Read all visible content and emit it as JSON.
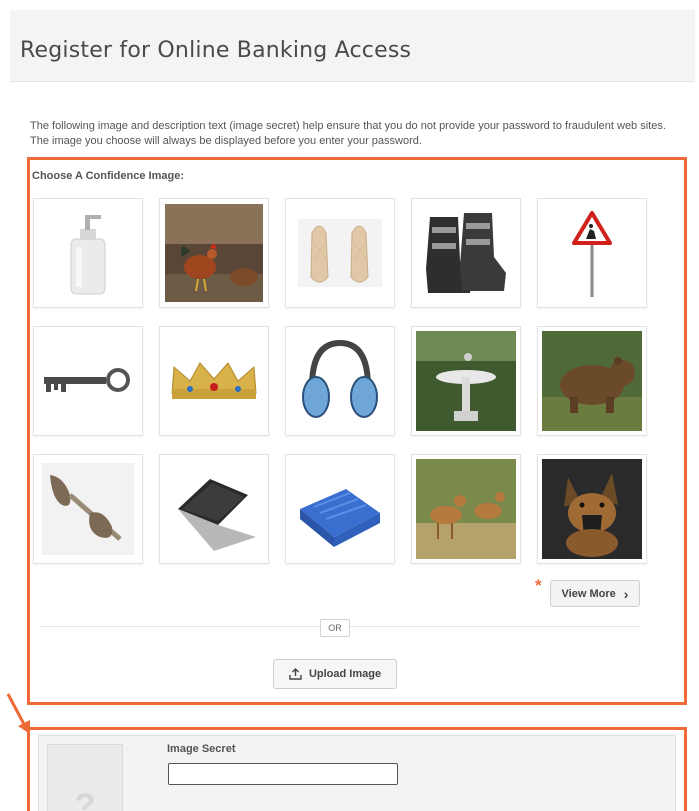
{
  "header": {
    "title": "Register for Online Banking Access"
  },
  "description": "The following image and description text (image secret) help ensure that you do not provide your password to fraudulent web sites. The image you choose will always be displayed before you enter your password.",
  "confidence": {
    "label": "Choose A Confidence Image:",
    "images": [
      {
        "icon": "soap-dispenser-icon"
      },
      {
        "icon": "rooster-icon"
      },
      {
        "icon": "ballet-shoes-icon"
      },
      {
        "icon": "ski-boots-icon"
      },
      {
        "icon": "road-sign-icon"
      },
      {
        "icon": "key-icon"
      },
      {
        "icon": "crown-icon"
      },
      {
        "icon": "earmuffs-icon"
      },
      {
        "icon": "fountain-icon"
      },
      {
        "icon": "bear-icon"
      },
      {
        "icon": "sunglasses-icon"
      },
      {
        "icon": "laptop-icon"
      },
      {
        "icon": "ice-pack-icon"
      },
      {
        "icon": "deer-icon"
      },
      {
        "icon": "dog-icon"
      }
    ],
    "view_more_label": "View More",
    "view_more_chevron": "›",
    "asterisk": "*",
    "or_label": "OR",
    "upload_label": "Upload Image",
    "accent_color": "#ee6a37"
  },
  "image_secret": {
    "label": "Image Secret",
    "value": "",
    "placeholder_glyph": "?"
  }
}
